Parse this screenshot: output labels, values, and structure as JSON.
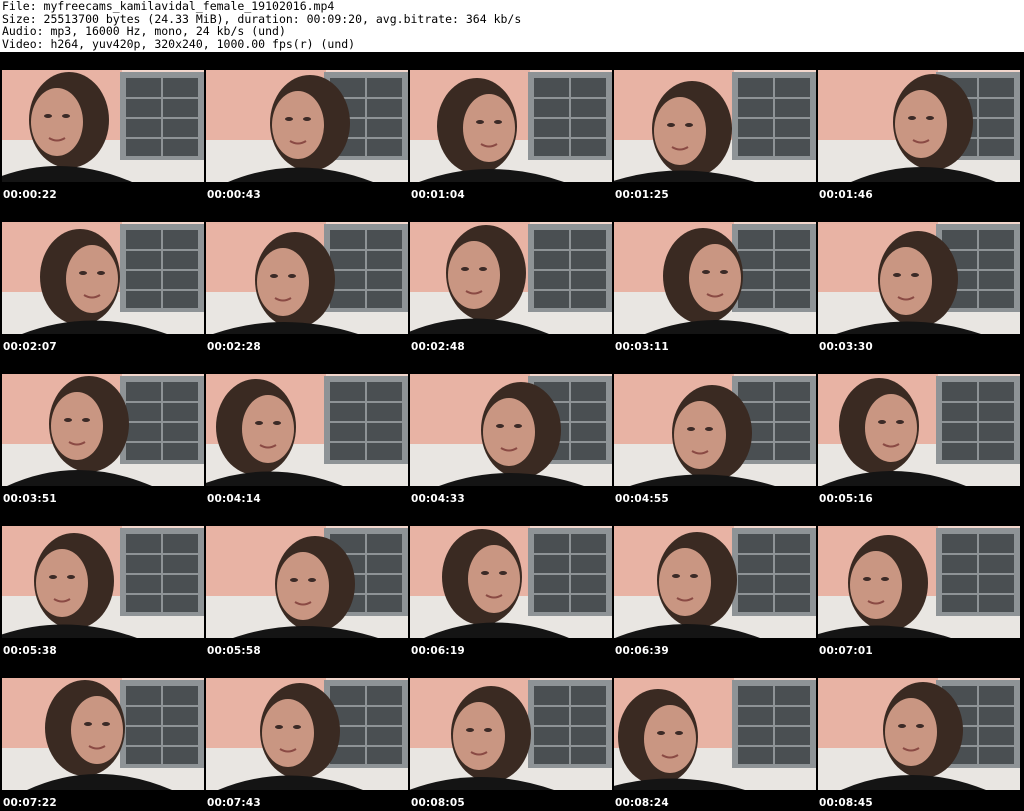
{
  "header": {
    "file_line": "File: myfreecams_kamilavidal_female_19102016.mp4",
    "size_line": "Size: 25513700 bytes (24.33 MiB), duration: 00:09:20, avg.bitrate: 364 kb/s",
    "audio_line": "Audio: mp3, 16000 Hz, mono, 24 kb/s (und)",
    "video_line": "Video: h264, yuv420p, 320x240, 1000.00 fps(r) (und)"
  },
  "thumbnails": [
    {
      "timestamp": "00:00:22"
    },
    {
      "timestamp": "00:00:43"
    },
    {
      "timestamp": "00:01:04"
    },
    {
      "timestamp": "00:01:25"
    },
    {
      "timestamp": "00:01:46"
    },
    {
      "timestamp": "00:02:07"
    },
    {
      "timestamp": "00:02:28"
    },
    {
      "timestamp": "00:02:48"
    },
    {
      "timestamp": "00:03:11"
    },
    {
      "timestamp": "00:03:30"
    },
    {
      "timestamp": "00:03:51"
    },
    {
      "timestamp": "00:04:14"
    },
    {
      "timestamp": "00:04:33"
    },
    {
      "timestamp": "00:04:55"
    },
    {
      "timestamp": "00:05:16"
    },
    {
      "timestamp": "00:05:38"
    },
    {
      "timestamp": "00:05:58"
    },
    {
      "timestamp": "00:06:19"
    },
    {
      "timestamp": "00:06:39"
    },
    {
      "timestamp": "00:07:01"
    },
    {
      "timestamp": "00:07:22"
    },
    {
      "timestamp": "00:07:43"
    },
    {
      "timestamp": "00:08:05"
    },
    {
      "timestamp": "00:08:24"
    },
    {
      "timestamp": "00:08:45"
    }
  ],
  "colors": {
    "wall_pink": "#e8b3a4",
    "wall_light": "#f2d6cc",
    "window_dark": "#4a4f52",
    "window_frame": "#8e9396",
    "hair": "#3a2a22",
    "skin": "#c99682",
    "shirt": "#141414"
  }
}
